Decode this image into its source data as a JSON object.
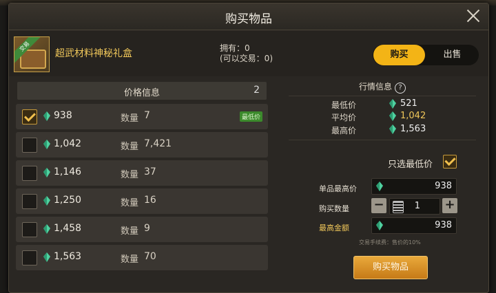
{
  "dialog": {
    "title": "购买物品"
  },
  "item": {
    "name": "超武材料神秘礼盒",
    "badge": "交易",
    "own_line1": "拥有：0",
    "own_line2": "(可以交易：0)"
  },
  "tabs": {
    "buy": "购买",
    "sell": "出售"
  },
  "price_list": {
    "header": "价格信息",
    "count": "2",
    "qty_label": "数量",
    "lowest_badge": "最低价",
    "rows": [
      {
        "price": "938",
        "qty": "7",
        "checked": true,
        "lowest": true
      },
      {
        "price": "1,042",
        "qty": "7,421",
        "checked": false
      },
      {
        "price": "1,146",
        "qty": "37",
        "checked": false
      },
      {
        "price": "1,250",
        "qty": "16",
        "checked": false
      },
      {
        "price": "1,458",
        "qty": "9",
        "checked": false
      },
      {
        "price": "1,563",
        "qty": "70",
        "checked": false
      }
    ]
  },
  "market": {
    "title": "行情信息",
    "help": "?",
    "min_label": "最低价",
    "min_value": "521",
    "avg_label": "平均价",
    "avg_value": "1,042",
    "max_label": "最高价",
    "max_value": "1,563"
  },
  "order": {
    "only_lowest_label": "只选最低价",
    "only_lowest_checked": true,
    "max_unit_label": "单品最高价",
    "max_unit_value": "938",
    "qty_label": "购买数量",
    "qty_value": "1",
    "minus": "−",
    "plus": "+",
    "max_total_label": "最高金额",
    "max_total_value": "938",
    "fee_note": "交易手续费：售价的10%",
    "buy_button": "购买物品"
  },
  "colors": {
    "accent": "#f3b416",
    "gem": "#4fd1a0",
    "highlight_value": "#f0c75a"
  }
}
